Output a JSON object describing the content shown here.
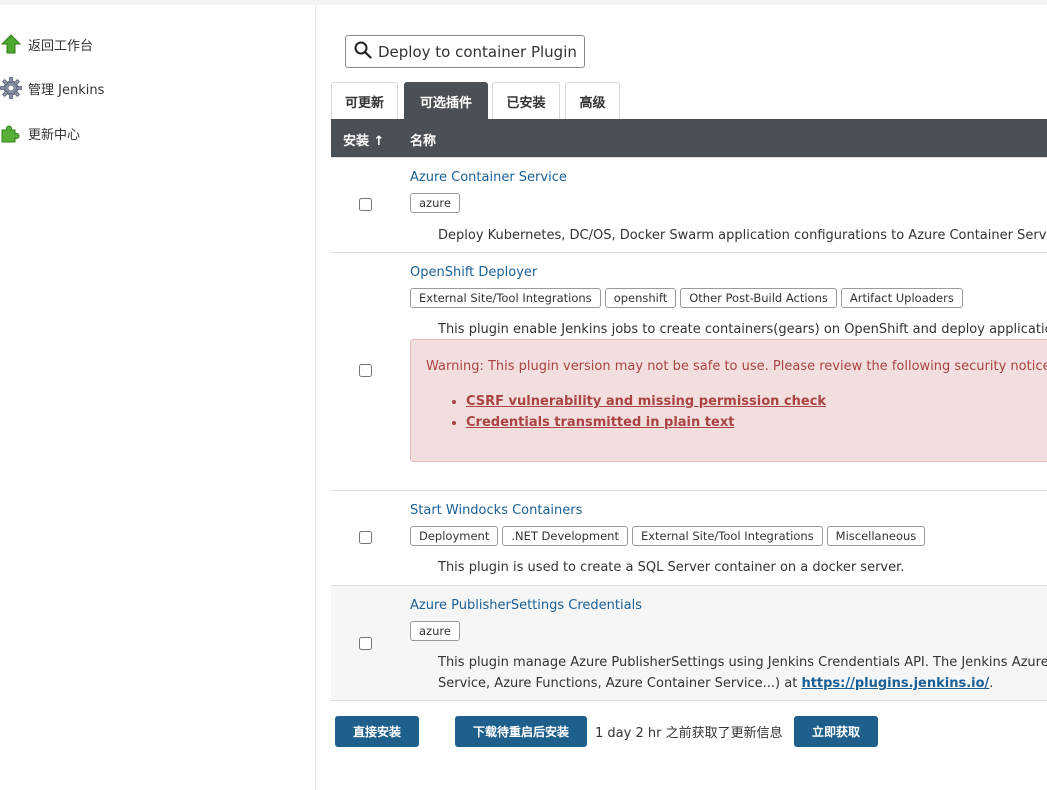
{
  "sidebar": {
    "items": [
      {
        "label": "返回工作台",
        "icon": "up-arrow-icon"
      },
      {
        "label": "管理 Jenkins",
        "icon": "gear-icon"
      },
      {
        "label": "更新中心",
        "icon": "puzzle-icon"
      }
    ]
  },
  "search": {
    "value": "Deploy to container Plugin"
  },
  "tabs": [
    {
      "label": "可更新",
      "active": false
    },
    {
      "label": "可选插件",
      "active": true
    },
    {
      "label": "已安装",
      "active": false
    },
    {
      "label": "高级",
      "active": false
    }
  ],
  "table": {
    "headers": {
      "install": "安装 ↑",
      "name": "名称"
    },
    "rows": [
      {
        "name": "Azure Container Service",
        "tags": [
          "azure"
        ],
        "description": "Deploy Kubernetes, DC/OS, Docker Swarm application configurations to Azure Container Service cl",
        "checked": false
      },
      {
        "name": "OpenShift Deployer",
        "tags": [
          "External Site/Tool Integrations",
          "openshift",
          "Other Post-Build Actions",
          "Artifact Uploaders"
        ],
        "description": "This plugin enable Jenkins jobs to create containers(gears) on OpenShift and deploy applications to",
        "warning": {
          "text": "Warning: This plugin version may not be safe to use. Please review the following security notices:",
          "links": [
            "CSRF vulnerability and missing permission check",
            "Credentials transmitted in plain text"
          ]
        },
        "checked": false
      },
      {
        "name": "Start Windocks Containers",
        "tags": [
          "Deployment",
          ".NET Development",
          "External Site/Tool Integrations",
          "Miscellaneous"
        ],
        "description": "This plugin is used to create a SQL Server container on a docker server.",
        "checked": false
      },
      {
        "name": "Azure PublisherSettings Credentials",
        "tags": [
          "azure"
        ],
        "description_line1": "This plugin manage Azure PublisherSettings using Jenkins Crendentials API. The Jenkins Azure Publ",
        "description_line2_prefix": "Service, Azure Functions, Azure Container Service...) at ",
        "description_link": "https://plugins.jenkins.io/",
        "description_line2_suffix": ".",
        "checked": false
      }
    ]
  },
  "footer": {
    "install_now": "直接安装",
    "download_restart": "下载待重启后安装",
    "update_info": "1 day 2 hr 之前获取了更新信息",
    "check_now": "立即获取"
  },
  "colors": {
    "header_bg": "#4b4f56",
    "link": "#1a5f96",
    "button": "#1e5f8c",
    "warning_bg": "#f2dede",
    "warning_text": "#a94442"
  }
}
